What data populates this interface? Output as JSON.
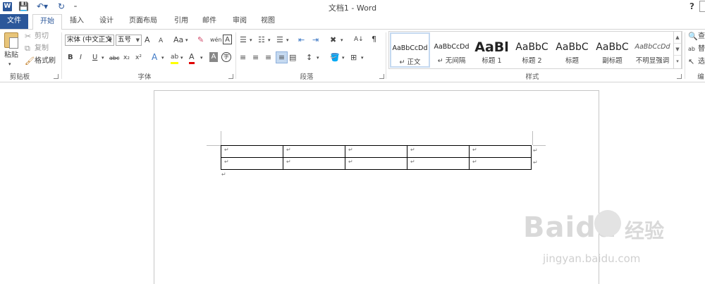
{
  "app": {
    "title": "文档1 - Word",
    "help": "?"
  },
  "tabs": [
    {
      "label": "文件"
    },
    {
      "label": "开始"
    },
    {
      "label": "插入"
    },
    {
      "label": "设计"
    },
    {
      "label": "页面布局"
    },
    {
      "label": "引用"
    },
    {
      "label": "邮件"
    },
    {
      "label": "审阅"
    },
    {
      "label": "视图"
    }
  ],
  "clipboard": {
    "paste": "粘贴",
    "cut": "剪切",
    "copy": "复制",
    "format_painter": "格式刷",
    "group_label": "剪贴板"
  },
  "font": {
    "font_name": "宋体 (中文正文",
    "font_size": "五号",
    "grow": "A",
    "shrink": "A",
    "change_case": "Aa",
    "clear_format": "✎",
    "phonetic": "wén",
    "char_border": "A",
    "bold": "B",
    "italic": "I",
    "underline": "U",
    "strikethrough": "abc",
    "subscript": "x₂",
    "superscript": "x²",
    "text_effect": "A",
    "highlight": "ab",
    "font_color": "A",
    "char_shading": "A",
    "enclose": "字",
    "group_label": "字体"
  },
  "paragraph": {
    "group_label": "段落"
  },
  "styles": {
    "items": [
      {
        "preview": "AaBbCcDd",
        "name": "↵ 正文"
      },
      {
        "preview": "AaBbCcDd",
        "name": "↵ 无间隔"
      },
      {
        "preview": "AaBl",
        "name": "标题 1"
      },
      {
        "preview": "AaBbC",
        "name": "标题 2"
      },
      {
        "preview": "AaBbC",
        "name": "标题"
      },
      {
        "preview": "AaBbC",
        "name": "副标题"
      },
      {
        "preview": "AaBbCcDd",
        "name": "不明显强调"
      }
    ],
    "group_label": "样式"
  },
  "editing": {
    "find": "查",
    "replace": "替",
    "select": "选",
    "group_label": "编"
  },
  "document": {
    "para_mark": "↵",
    "table": {
      "rows": [
        [
          "↵",
          "↵",
          "↵",
          "↵",
          "↵"
        ],
        [
          "↵",
          "↵",
          "↵",
          "↵",
          "↵"
        ]
      ]
    }
  },
  "watermark": {
    "brand": "Baidu",
    "brand_cn": "经验",
    "url": "jingyan.baidu.com"
  }
}
